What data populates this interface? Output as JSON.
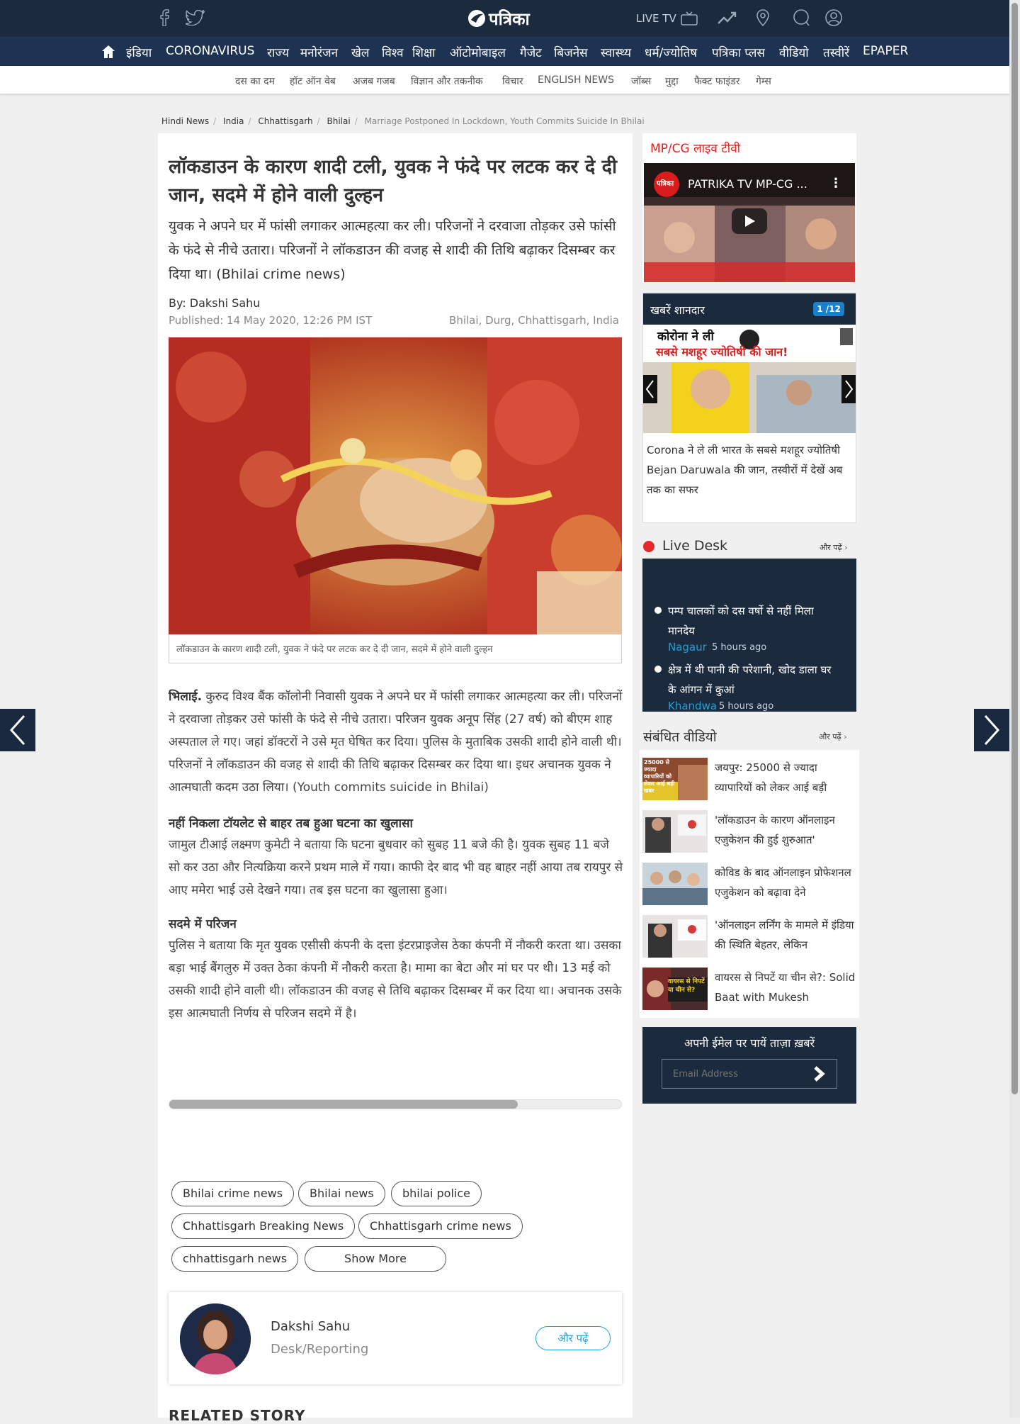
{
  "header": {
    "logo_text": "पत्रिका",
    "live_tv_label": "LIVE TV"
  },
  "nav": {
    "items": [
      "इंडिया",
      "CORONAVIRUS",
      "राज्य",
      "मनोरंजन",
      "खेल",
      "विश्व",
      "शिक्षा",
      "ऑटोमोबाइल",
      "गैजेट",
      "बिजनेस",
      "स्वास्थ्य",
      "धर्म/ज्योतिष",
      "पत्रिका प्लस",
      "वीडियो",
      "तस्वीरें",
      "EPAPER"
    ]
  },
  "subnav": {
    "items": [
      "दस का दम",
      "हॉट ऑन वेब",
      "अजब गजब",
      "विज्ञान और तकनीक",
      "विचार",
      "ENGLISH NEWS",
      "जॉब्स",
      "मुद्दा",
      "फैक्ट फाइंडर",
      "गेम्स"
    ]
  },
  "breadcrumb": {
    "items": [
      "Hindi News",
      "India",
      "Chhattisgarh",
      "Bhilai"
    ],
    "current": "Marriage Postponed In Lockdown, Youth Commits Suicide In Bhilai"
  },
  "article": {
    "headline": "लॉकडाउन के कारण शादी टली, युवक ने फंदे पर लटक कर दे दी जान, सदमे में होने वाली दुल्हन",
    "summary": "युवक ने अपने घर में फांसी लगाकर आत्महत्या कर ली। परिजनों ने दरवाजा तोड़कर उसे फांसी के फंदे से नीचे उतारा। परिजनों ने लॉकडाउन की वजह से शादी की तिथि बढ़ाकर दिसम्बर कर दिया था। (Bhilai crime news)",
    "byline": "By: Dakshi Sahu",
    "published": "Published: 14 May 2020, 12:26 PM IST",
    "location": "Bhilai, Durg, Chhattisgarh, India",
    "image_caption": "लॉकडाउन के कारण शादी टली, युवक ने फंदे पर लटक कर दे दी जान, सदमे में होने वाली दुल्हन",
    "dateline": "भिलाई.",
    "para1": " कुरुद विश्व बैंक कॉलोनी निवासी युवक ने अपने घर में फांसी लगाकर आत्महत्या कर ली। परिजनों ने दरवाजा तोड़कर उसे फांसी के फंदे से नीचे उतारा। परिजन युवक अनूप सिंह (27 वर्ष) को बीएम शाह अस्पताल ले गए। जहां डॉक्टरों ने उसे मृत घेषित कर दिया। पुलिस के मुताबिक उसकी शादी होने वाली थी। परिजनों ने लॉकडाउन की वजह से शादी की तिथि बढ़ाकर दिसम्बर कर दिया था। इधर अचानक युवक ने आत्मघाती कदम उठा लिया। (Youth commits suicide in Bhilai)",
    "heading2": "नहीं निकला टॉयलेट से बाहर तब हुआ घटना का खुलासा",
    "para2": "जामुल टीआई लक्ष्मण कुमेटी ने बताया कि घटना बुधवार को सुबह 11 बजे की है। युवक सुबह 11 बजे सो कर उठा और नित्यक्रिया करने प्रथम माले में गया। काफी देर बाद भी वह बाहर नहीं आया तब रायपुर से आए ममेरा भाई उसे देखने गया। तब इस घटना का खुलासा हुआ।",
    "heading3": "सदमे में परिजन",
    "para3": "पुलिस ने बताया कि मृत युवक एसीसी कंपनी के दत्ता इंटरप्राइजेस ठेका कंपनी में नौकरी करता था। उसका बड़ा भाई बैंगलुरु में उक्त ठेका कंपनी में नौकरी करता है। मामा का बेटा और मां घर पर थी। 13 मई को उसकी शादी होने वाली थी। लॉकडाउन की वजह से तिथि बढ़ाकर दिसम्बर में कर दिया था। अचानक उसके इस आत्मघाती निर्णय से परिजन सदमे में है।"
  },
  "tags": [
    "Bhilai crime news",
    "Bhilai news",
    "bhilai police",
    "Chhattisgarh Breaking News",
    "Chhattisgarh crime news",
    "chhattisgarh news"
  ],
  "show_more_label": "Show More",
  "author": {
    "name": "Dakshi Sahu",
    "role": "Desk/Reporting",
    "more_label": "और पढ़ें"
  },
  "related_story_label": "RELATED STORY",
  "sidebar": {
    "live_tv_title": "MP/CG लाइव टीवी",
    "video_title": "PATRIKA TV MP-CG ...",
    "video_badge": "पत्रिका",
    "slideshow_title": "खबरें शानदार",
    "slideshow_counter": "1 /12",
    "slide_headline_line1": "कोरोना ने ली",
    "slide_headline_line2": "सबसे मशहूर ज्योतिषी की जान!",
    "slide_caption": "Corona ने ले ली भारत के सबसे मशहूर ज्योतिषी Bejan Daruwala की जान, तस्वीरों में देखें अब तक का सफर",
    "live_desk_title": "Live Desk",
    "more_label": "और पढ़ें",
    "live_items": [
      {
        "text": "पम्प चालकों को दस वर्षो से नहीं मिला मानदेय",
        "place": "Nagaur",
        "time": "5 hours ago"
      },
      {
        "text": "क्षेत्र में थी पानी की परेशानी, खोद डाला घर के आंगन में कुआं",
        "place": "Khandwa",
        "time": "5 hours ago"
      }
    ],
    "related_videos_title": "संबंधित वीडियो",
    "videos": [
      {
        "title": "जयपुर: 25000 से ज्यादा व्यापारियों को लेकर आई बड़ी",
        "thumb_text": "25000 से ज्यादा व्यापारियों को लेकर आई बड़ी खबर"
      },
      {
        "title": "'लॉकडाउन के कारण ऑनलाइन एजुकेशन की हुई शुरुआत'",
        "thumb_text": ""
      },
      {
        "title": "कोविड के बाद ऑनलाइन प्रोफेशनल एजुकेशन को बढ़ावा देने",
        "thumb_text": ""
      },
      {
        "title": "'ऑनलाइन लर्निंग के मामले में इंडिया की स्थिति बेहतर, लेकिन",
        "thumb_text": ""
      },
      {
        "title": "वायरस से निपटें या चीन से?: Solid Baat with Mukesh",
        "thumb_text": "वायरस से निपटें या चीन से?"
      }
    ],
    "newsletter_title": "अपनी ईमेल पर पायें ताज़ा ख़बरें",
    "newsletter_placeholder": "Email Address"
  }
}
